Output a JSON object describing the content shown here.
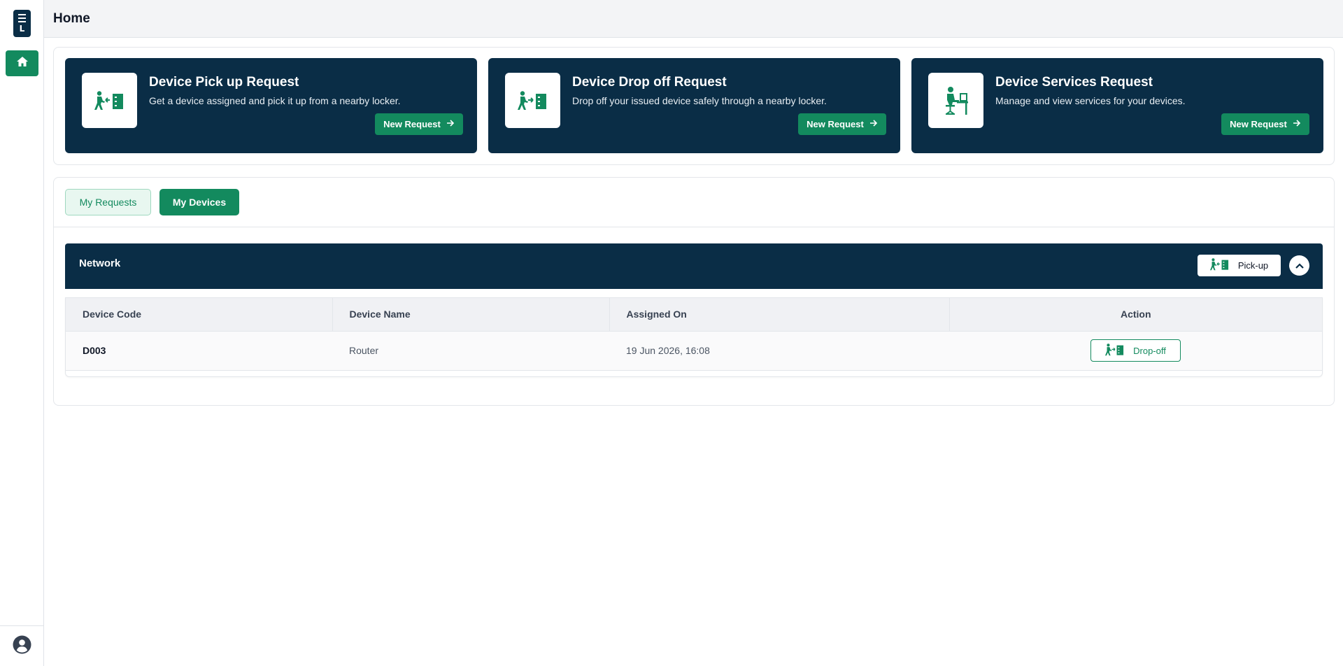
{
  "app": {
    "logo_letter": "L"
  },
  "sidebar": {
    "home_icon": "home-icon",
    "user_icon": "user-circle-icon"
  },
  "header": {
    "title": "Home"
  },
  "cards": [
    {
      "title": "Device Pick up Request",
      "description": "Get a device assigned and pick it up from a nearby locker.",
      "button": "New Request",
      "icon": "pickup-locker-icon"
    },
    {
      "title": "Device Drop off Request",
      "description": "Drop off your issued device safely through a nearby locker.",
      "button": "New Request",
      "icon": "dropoff-locker-icon"
    },
    {
      "title": "Device Services Request",
      "description": "Manage and view services for your devices.",
      "button": "New Request",
      "icon": "desk-worker-icon"
    }
  ],
  "tabs": [
    {
      "label": "My Requests",
      "active": false
    },
    {
      "label": "My Devices",
      "active": true
    }
  ],
  "group": {
    "title": "Network",
    "pickup_label": "Pick-up"
  },
  "table": {
    "columns": [
      "Device Code",
      "Device Name",
      "Assigned On",
      "Action"
    ],
    "rows": [
      {
        "code": "D003",
        "name": "Router",
        "assigned_on": "19 Jun 2026, 16:08",
        "action": "Drop-off"
      }
    ]
  },
  "colors": {
    "navy": "#0a2d46",
    "green": "#138a5e",
    "light_green": "#e8f7f0"
  }
}
